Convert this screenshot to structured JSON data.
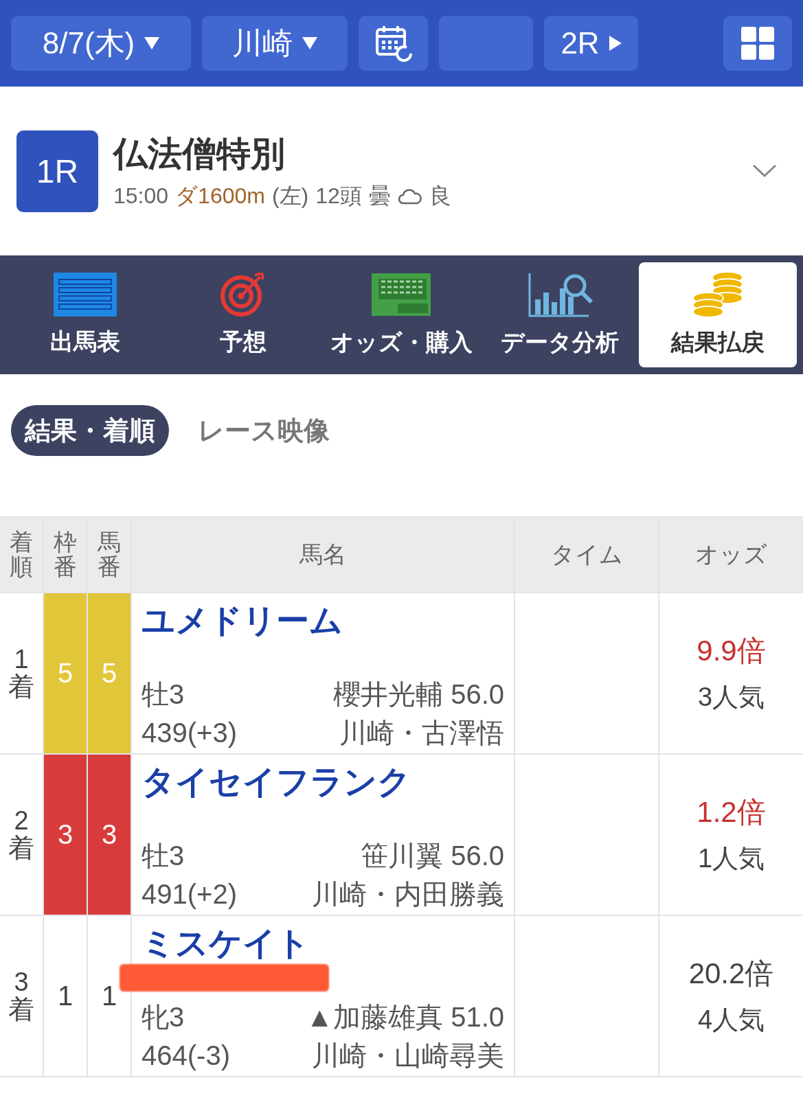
{
  "top_bar": {
    "date": {
      "label": "8/7(木)"
    },
    "venue": {
      "label": "川崎"
    },
    "next_race": {
      "label": "2R"
    }
  },
  "race": {
    "number": "1R",
    "name": "仏法僧特別",
    "time": "15:00",
    "course": "ダ1600m",
    "direction": "(左)",
    "runners": "12頭",
    "weather": "曇",
    "going": "良"
  },
  "nav_tabs": [
    {
      "kind": "entries",
      "label": "出馬表",
      "selected": false
    },
    {
      "kind": "prediction",
      "label": "予想",
      "selected": false
    },
    {
      "kind": "bet",
      "label": "オッズ・購入",
      "selected": false
    },
    {
      "kind": "analysis",
      "label": "データ分析",
      "selected": false
    },
    {
      "kind": "payout",
      "label": "結果払戻",
      "selected": true
    }
  ],
  "sub_tabs": [
    {
      "label": "結果・着順",
      "selected": true
    },
    {
      "label": "レース映像",
      "selected": false
    }
  ],
  "table": {
    "columns": [
      "着順",
      "枠番",
      "馬番",
      "馬名",
      "タイム",
      "オッズ"
    ],
    "rows": [
      {
        "finish": "1着",
        "frame": "5",
        "color": "#e2c63a",
        "number": "5",
        "horse": "ユメドリーム",
        "sex_age": "牡3",
        "weight": "439(+3)",
        "jockey": "櫻井光輔 56.0",
        "trainer": "川崎・古澤悟",
        "odds": "9.9倍",
        "odds_highlighted": true,
        "popularity": "3人気"
      },
      {
        "finish": "2着",
        "frame": "3",
        "color": "#d83b3b",
        "number": "3",
        "horse": "タイセイフランク",
        "sex_age": "牡3",
        "weight": "491(+2)",
        "jockey": "笹川翼 56.0",
        "trainer": "川崎・内田勝義",
        "odds": "1.2倍",
        "odds_highlighted": true,
        "popularity": "1人気"
      },
      {
        "finish": "3着",
        "frame": "1",
        "color": "#ffffff",
        "number": "1",
        "horse": "ミスケイト",
        "sex_age": "牝3",
        "weight": "464(-3)",
        "jockey": "▲加藤雄真 51.0",
        "trainer": "川崎・山崎尋美",
        "odds": "20.2倍",
        "odds_highlighted": false,
        "popularity": "4人気"
      }
    ]
  }
}
